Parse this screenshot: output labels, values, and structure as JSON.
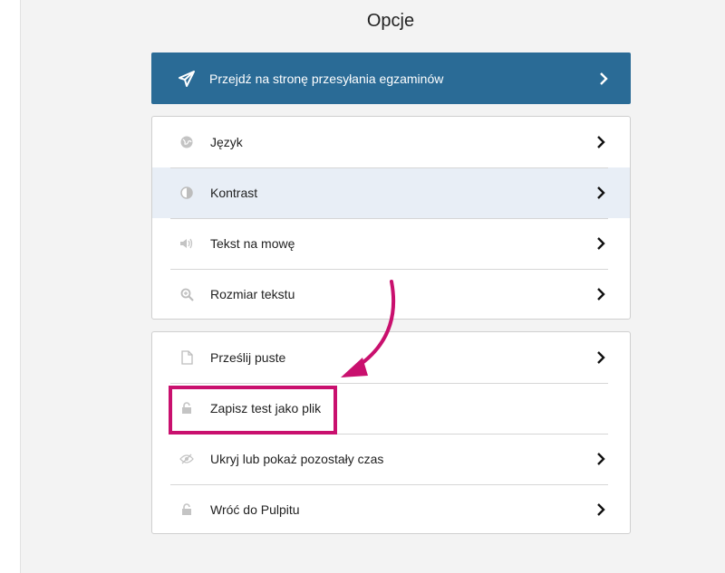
{
  "page": {
    "title": "Opcje"
  },
  "primary": {
    "label": "Przejdź na stronę przesyłania egzaminów",
    "icon": "paper-plane-icon"
  },
  "group1": {
    "items": [
      {
        "label": "Język",
        "icon": "globe-icon"
      },
      {
        "label": "Kontrast",
        "icon": "contrast-icon"
      },
      {
        "label": "Tekst na mowę",
        "icon": "speaker-icon"
      },
      {
        "label": "Rozmiar tekstu",
        "icon": "zoom-icon"
      }
    ]
  },
  "group2": {
    "items": [
      {
        "label": "Prześlij puste",
        "icon": "document-icon"
      },
      {
        "label": "Zapisz test jako plik",
        "icon": "unlock-icon"
      },
      {
        "label": "Ukryj lub pokaż pozostały czas",
        "icon": "eye-slash-icon"
      },
      {
        "label": "Wróć do Pulpitu",
        "icon": "unlock-icon"
      }
    ]
  },
  "colors": {
    "primary": "#2a6b96",
    "active_row": "#e8eef6",
    "highlight": "#c9106e"
  }
}
